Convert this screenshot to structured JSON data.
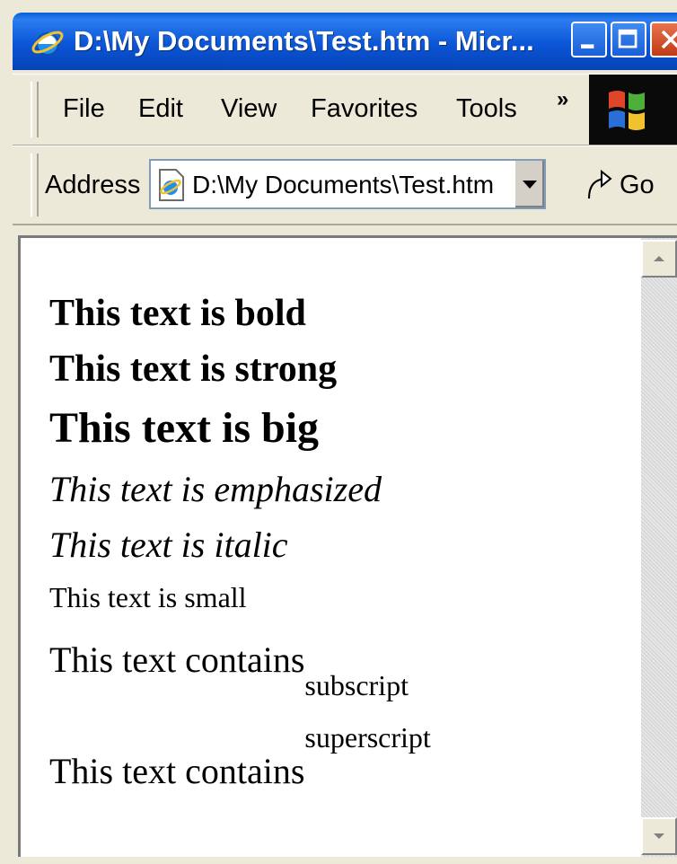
{
  "window": {
    "title": "D:\\My Documents\\Test.htm - Micr...",
    "icon": "ie-icon"
  },
  "menu": {
    "items": [
      "File",
      "Edit",
      "View",
      "Favorites",
      "Tools"
    ],
    "overflow_label": "»"
  },
  "address": {
    "label": "Address",
    "value": "D:\\My Documents\\Test.htm",
    "go_label": "Go"
  },
  "page": {
    "bold": "This text is bold",
    "strong": "This text is strong",
    "big": "This text is big",
    "emphasized": "This text is emphasized",
    "italic": "This text is italic",
    "small": "This text is small",
    "subscript_prefix": "This text contains",
    "subscript": "subscript",
    "superscript_prefix": "This text contains",
    "superscript": "superscript"
  },
  "colors": {
    "titlebar": "#0b55d6",
    "chrome": "#ece9d8",
    "content_bg": "#ffffff"
  }
}
